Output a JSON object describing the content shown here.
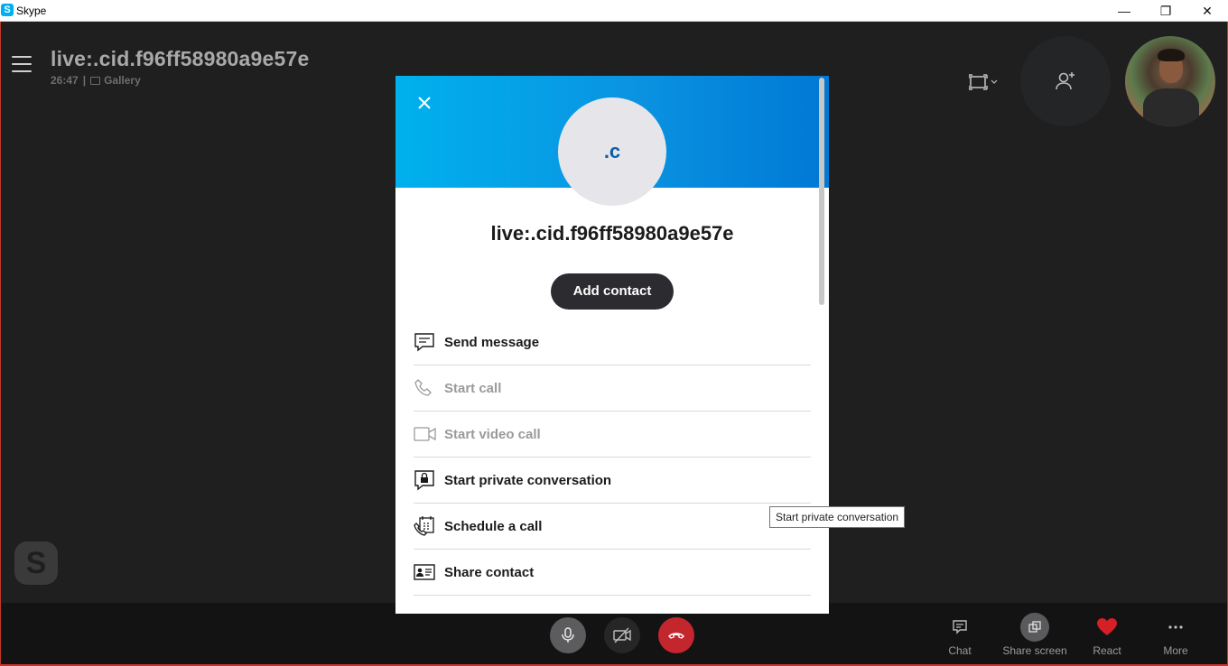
{
  "window": {
    "app_title": "Skype",
    "app_icon_letter": "S",
    "minimize_glyph": "—",
    "maximize_glyph": "❐",
    "close_glyph": "✕"
  },
  "call": {
    "title": "live:.cid.f96ff58980a9e57e",
    "duration": "26:47",
    "separator": "|",
    "view_mode": "Gallery"
  },
  "watermark_letter": "S",
  "profile": {
    "avatar_initials": ".c",
    "name": "live:.cid.f96ff58980a9e57e",
    "add_contact_label": "Add contact",
    "actions": [
      {
        "label": "Send message",
        "icon": "message-icon",
        "enabled": true
      },
      {
        "label": "Start call",
        "icon": "phone-icon",
        "enabled": false
      },
      {
        "label": "Start video call",
        "icon": "video-camera-icon",
        "enabled": false
      },
      {
        "label": "Start private conversation",
        "icon": "lock-chat-icon",
        "enabled": true
      },
      {
        "label": "Schedule a call",
        "icon": "calendar-phone-icon",
        "enabled": true
      },
      {
        "label": "Share contact",
        "icon": "contact-card-icon",
        "enabled": true
      }
    ]
  },
  "tooltip": "Start private conversation",
  "toolbar": {
    "chat_label": "Chat",
    "share_screen_label": "Share screen",
    "react_label": "React",
    "more_label": "More"
  },
  "colors": {
    "header_gradient_start": "#00b1ee",
    "header_gradient_end": "#0078d4",
    "hangup": "#c4262e",
    "react_heart": "#d42026"
  }
}
